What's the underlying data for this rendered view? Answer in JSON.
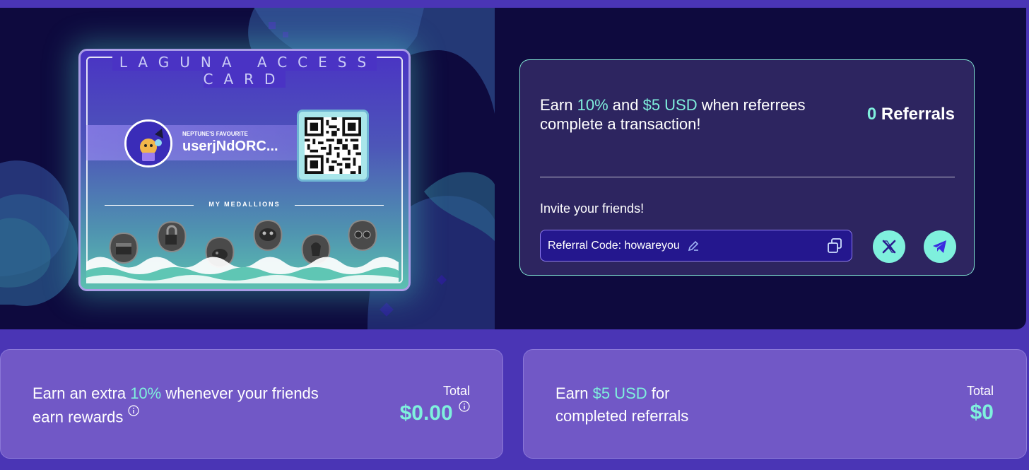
{
  "access_card": {
    "title": "LAGUNA ACCESS CARD",
    "subtitle": "NEPTUNE'S FAVOURITE",
    "username": "userjNdORC...",
    "medallions_label": "MY MEDALLIONS",
    "medallion_count": 6
  },
  "referral": {
    "headline_parts": [
      "Earn ",
      "10%",
      " and ",
      "$5 USD",
      " when referrees complete a transaction!"
    ],
    "count_value": "0",
    "count_label": " Referrals",
    "invite_label": "Invite your friends!",
    "code_text": "Referral Code: howareyou",
    "icons": [
      "edit-icon",
      "copy-icon",
      "x-icon",
      "telegram-icon"
    ]
  },
  "bottom_left": {
    "text_parts": [
      "Earn an extra ",
      "10%",
      " whenever your friends",
      "earn rewards"
    ],
    "total_label": "Total",
    "total_value": "$0.00"
  },
  "bottom_right": {
    "text_parts": [
      "Earn ",
      "$5 USD",
      " for",
      "completed referrals"
    ],
    "total_label": "Total",
    "total_value": "$0"
  },
  "colors": {
    "accent": "#7ff0dd",
    "page_bg": "#4a35b5",
    "hero_bg": "#0e0a3e",
    "panel_bg": "#2d2560",
    "bottom_card_bg": "#7158c6"
  }
}
